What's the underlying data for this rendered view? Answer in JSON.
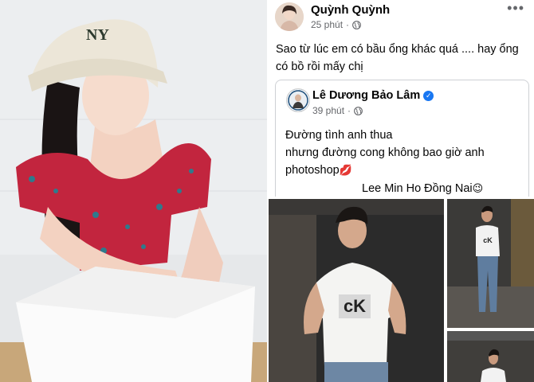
{
  "post": {
    "author": "Quỳnh Quỳnh",
    "time": "25 phút",
    "privacy_icon": "globe-icon",
    "more_icon": "more-options-icon",
    "text_line1": "Sao từ lúc em có bầu ổng khác quá .... hay ổng",
    "text_line2": "có bồ rồi mấy chị"
  },
  "shared": {
    "author": "Lê Dương Bảo Lâm",
    "verified_icon": "verified-badge-icon",
    "time": "39 phút",
    "line1": "Đường tình anh thua",
    "line2": "nhưng đường cong không bao giờ anh",
    "line3": "photoshop",
    "line3_emoji": "💋",
    "line4": "Lee Min Ho Đồng Nai",
    "line4_emoji": "😉"
  },
  "colors": {
    "name": "#050505",
    "meta": "#65676b",
    "verified": "#1877f2",
    "border": "#ced0d4"
  }
}
